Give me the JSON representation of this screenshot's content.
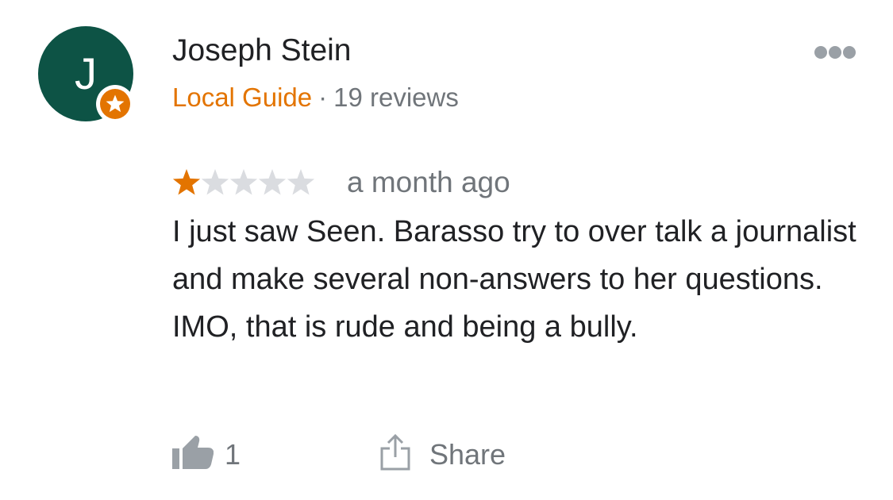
{
  "review": {
    "avatar": {
      "initial": "J",
      "color": "#0d5345",
      "badge_icon": "local-guide-star-icon",
      "badge_color": "#e37400"
    },
    "reviewer_name": "Joseph Stein",
    "local_guide_label": "Local Guide",
    "separator": "·",
    "review_count": "19 reviews",
    "more_icon": "more-horizontal-icon",
    "rating": {
      "value": 1,
      "max": 5,
      "filled_color": "#e37400",
      "empty_color": "#dadce0"
    },
    "time_ago": "a month ago",
    "text": "I just saw Seen. Barasso try to over talk a journalist and make several non-answers to her questions. IMO, that is rude and being a bully.",
    "actions": {
      "like_icon": "thumbs-up-icon",
      "like_count": "1",
      "share_icon": "share-icon",
      "share_label": "Share"
    }
  }
}
